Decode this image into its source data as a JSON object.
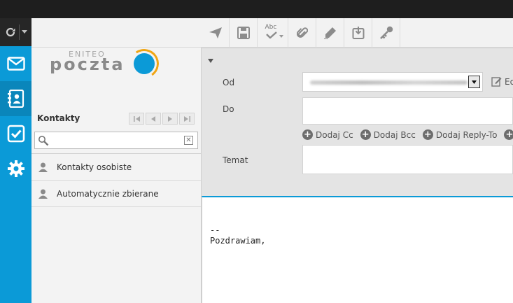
{
  "app": {
    "logo_small": "ENITEO",
    "logo_big": "poczta"
  },
  "rail": {
    "items": [
      {
        "name": "mail",
        "icon": "envelope-icon"
      },
      {
        "name": "contacts",
        "icon": "address-book-icon"
      },
      {
        "name": "tasks",
        "icon": "checkbox-icon"
      },
      {
        "name": "settings",
        "icon": "gear-icon"
      }
    ]
  },
  "toolbar": {
    "buttons": [
      "send-icon",
      "save-icon",
      "spellcheck-icon",
      "attachment-icon",
      "signature-icon",
      "insert-response-icon",
      "encryption-icon"
    ],
    "spell_label": "Abc"
  },
  "contacts": {
    "title": "Kontakty",
    "search_placeholder": "",
    "groups": [
      {
        "label": "Kontakty osobiste"
      },
      {
        "label": "Automatycznie zbierane"
      }
    ]
  },
  "compose": {
    "from_label": "Od",
    "to_label": "Do",
    "subject_label": "Temat",
    "edit_label": "Ed",
    "add_cc": "Dodaj Cc",
    "add_bcc": "Dodaj Bcc",
    "add_replyto": "Dodaj Reply-To",
    "add_followup": "Do",
    "to_value": "",
    "subject_value": "",
    "signature_sep": "--",
    "signature_text": "Pozdrawiam,"
  },
  "colors": {
    "accent": "#0b9ad7",
    "logo_orange": "#f0a614",
    "topbar": "#1e1e1e"
  }
}
